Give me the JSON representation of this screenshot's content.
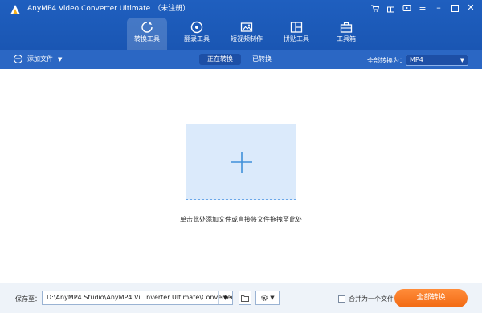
{
  "app": {
    "title": "AnyMP4 Video Converter Ultimate",
    "registration": "（未注册）",
    "icons": {
      "logo": "app-logo",
      "cart": "cart-icon",
      "gift": "gift-icon",
      "chat": "chat-icon",
      "menu": "menu-icon",
      "minimize": "minimize-icon",
      "maximize": "maximize-icon",
      "close": "close-icon"
    }
  },
  "toolbar": {
    "tools": [
      {
        "label": "转换工具",
        "icon": "convert-icon",
        "active": true
      },
      {
        "label": "翻录工具",
        "icon": "disc-icon",
        "active": false
      },
      {
        "label": "短视频制作",
        "icon": "image-icon",
        "active": false
      },
      {
        "label": "拼贴工具",
        "icon": "collage-icon",
        "active": false
      },
      {
        "label": "工具箱",
        "icon": "toolbox-icon",
        "active": false
      }
    ]
  },
  "subbar": {
    "add_file": "添加文件",
    "tabs": [
      {
        "label": "正在转换",
        "active": true
      },
      {
        "label": "已转换",
        "active": false
      }
    ],
    "convert_all_to": "全部转换为：",
    "format": "MP4"
  },
  "main": {
    "dropzone_hint": "单击此处添加文件或直接将文件拖拽至此处"
  },
  "bottom": {
    "save_to": "保存至：",
    "path": "D:\\AnyMP4 Studio\\AnyMP4 Vi...nverter Ultimate\\Converted",
    "merge_label": "合并为一个文件",
    "convert_all_button": "全部转换"
  },
  "colors": {
    "header_blue": "#1f5fbf",
    "subbar_blue": "#2b67c4",
    "dropzone_fill": "#dbeafb",
    "accent_orange": "#f26a13"
  }
}
